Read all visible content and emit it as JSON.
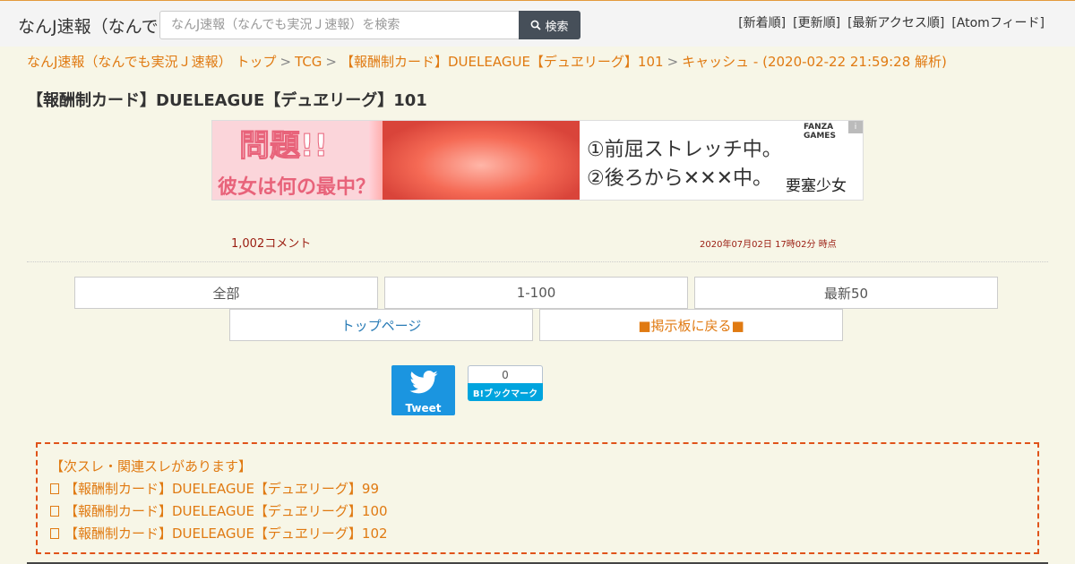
{
  "header": {
    "site_title": "なんJ速報（なんでも実況Ｊ速報）",
    "search_placeholder": "なんJ速報（なんでも実況Ｊ速報）を検索",
    "search_button": "検索",
    "links": [
      "[新着順]",
      "[更新順]",
      "[最新アクセス順]",
      "[Atomフィード]"
    ]
  },
  "breadcrumb": {
    "items": [
      "なんJ速報（なんでも実況Ｊ速報） トップ",
      "TCG",
      "【報酬制カード】DUELEAGUE【デュヱリーグ】101",
      "キャッシュ - (2020-02-22 21:59:28 解析)"
    ],
    "separator": ">"
  },
  "page_title": "【報酬制カード】DUELEAGUE【デュヱリーグ】101",
  "ad": {
    "question": "問題!!",
    "sub": "彼女は何の最中？",
    "line1": "①前屈ストレッチ中。",
    "line2": "②後ろから✕✕✕中。",
    "brand": "FANZA GAMES",
    "logo": "要塞少女"
  },
  "info": {
    "comment_count": "1,002コメント",
    "timestamp": "2020年07月02日 17時02分 時点"
  },
  "nav": {
    "all": "全部",
    "range": "1-100",
    "latest": "最新50",
    "top": "トップページ",
    "board": "■掲示板に戻る■"
  },
  "share": {
    "tweet": "Tweet",
    "hatena_count": "0",
    "hatena_label": "B!ブックマーク"
  },
  "related": {
    "heading": "【次スレ・関連スレがあります】",
    "items": [
      "【報酬制カード】DUELEAGUE【デュヱリーグ】99",
      "【報酬制カード】DUELEAGUE【デュヱリーグ】100",
      "【報酬制カード】DUELEAGUE【デュヱリーグ】102"
    ]
  }
}
